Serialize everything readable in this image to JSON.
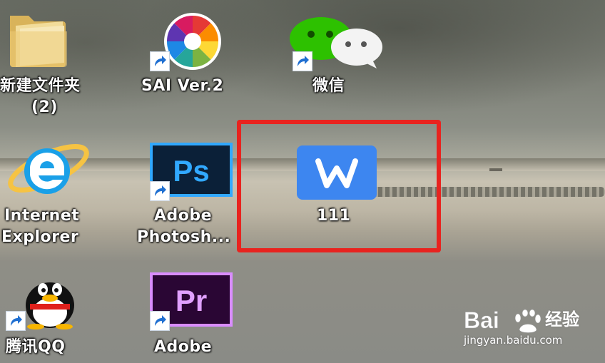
{
  "desktop": {
    "icons": [
      {
        "name": "新建文件夹",
        "line2": "(2)"
      },
      {
        "name": "SAI Ver.2"
      },
      {
        "name": "微信"
      },
      {
        "name": "Internet",
        "line2": "Explorer"
      },
      {
        "name": "Adobe",
        "line2": "Photosh..."
      },
      {
        "name": "111"
      },
      {
        "name": "腾讯QQ"
      },
      {
        "name": "Adobe"
      }
    ]
  },
  "highlight": {
    "color": "#e8231f"
  },
  "watermark": {
    "brand_left": "Bai",
    "brand_right": "经验",
    "url": "jingyan.baidu.com"
  }
}
